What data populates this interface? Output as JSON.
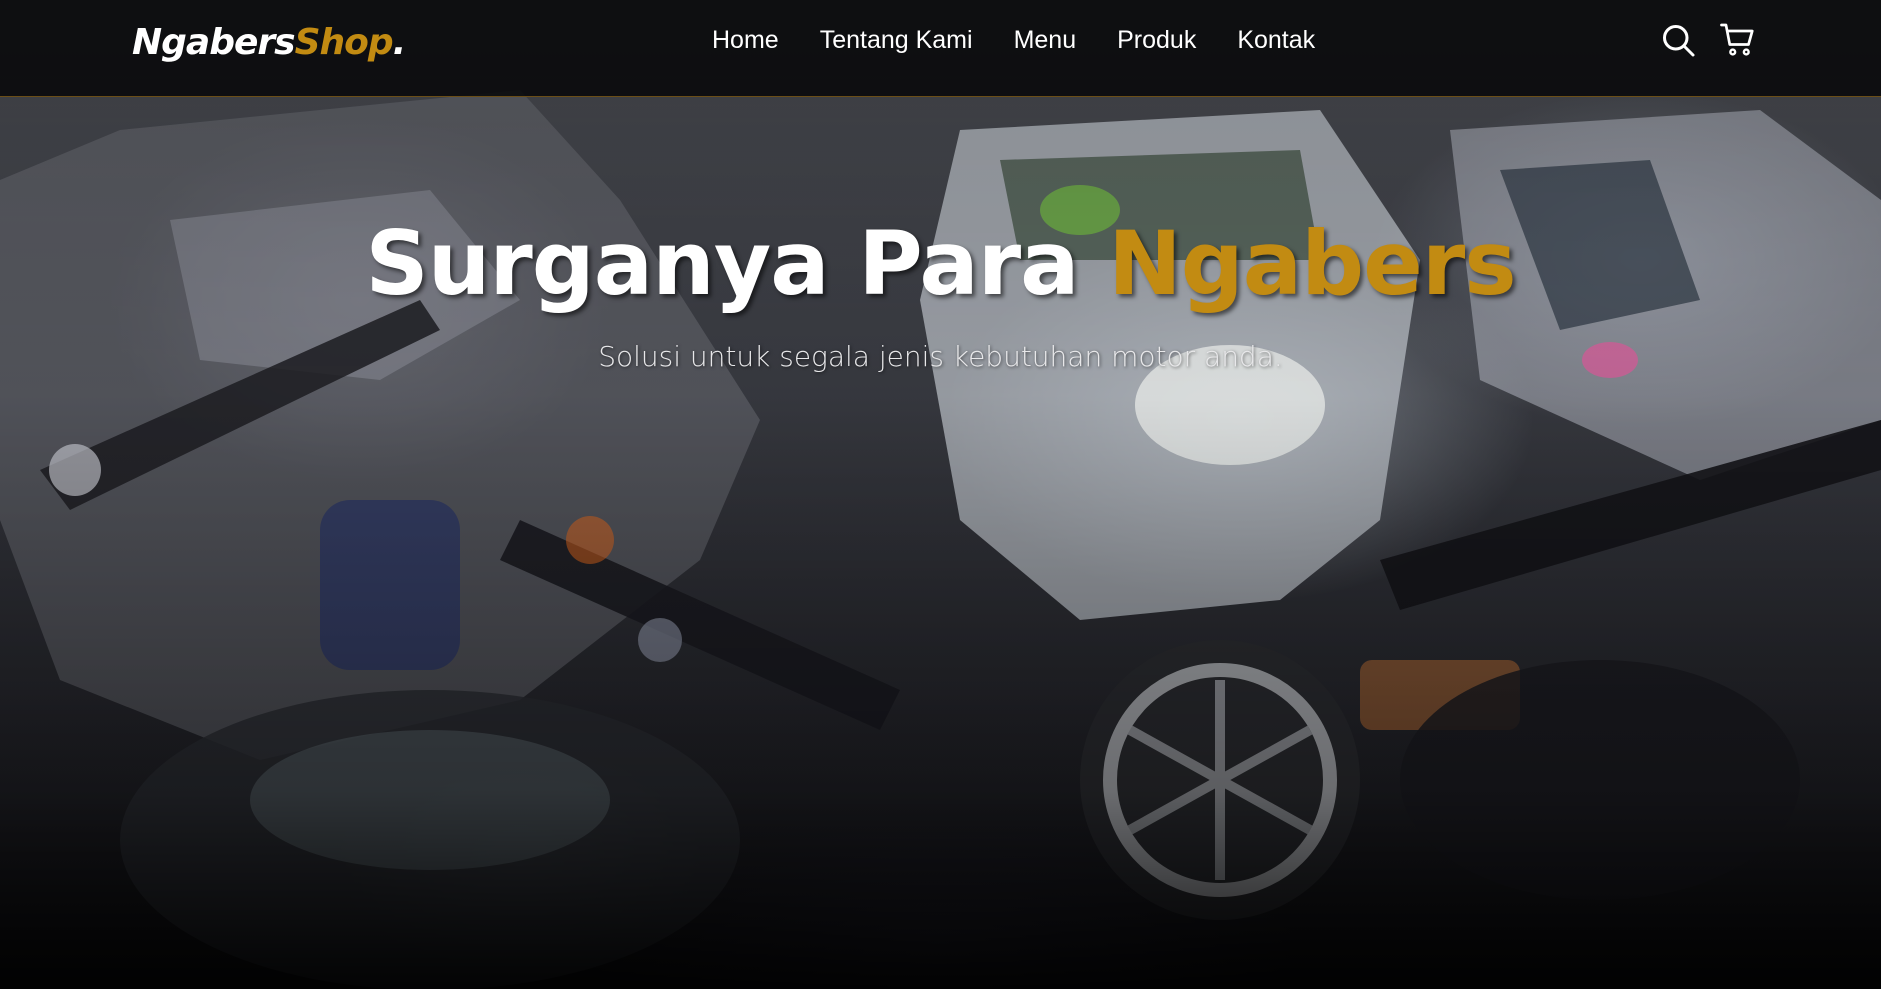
{
  "brand": {
    "name_main": "Ngabers",
    "name_accent": "Shop",
    "name_dot": ".",
    "accent_color": "#c28b12"
  },
  "nav": {
    "items": [
      {
        "label": "Home"
      },
      {
        "label": "Tentang Kami"
      },
      {
        "label": "Menu"
      },
      {
        "label": "Produk"
      },
      {
        "label": "Kontak"
      }
    ],
    "icons": [
      "search-icon",
      "shopping-cart-icon"
    ]
  },
  "hero": {
    "title_main": "Surganya Para ",
    "title_accent": "Ngabers",
    "subtitle": "Solusi untuk segala jenis kebutuhan motor anda."
  }
}
